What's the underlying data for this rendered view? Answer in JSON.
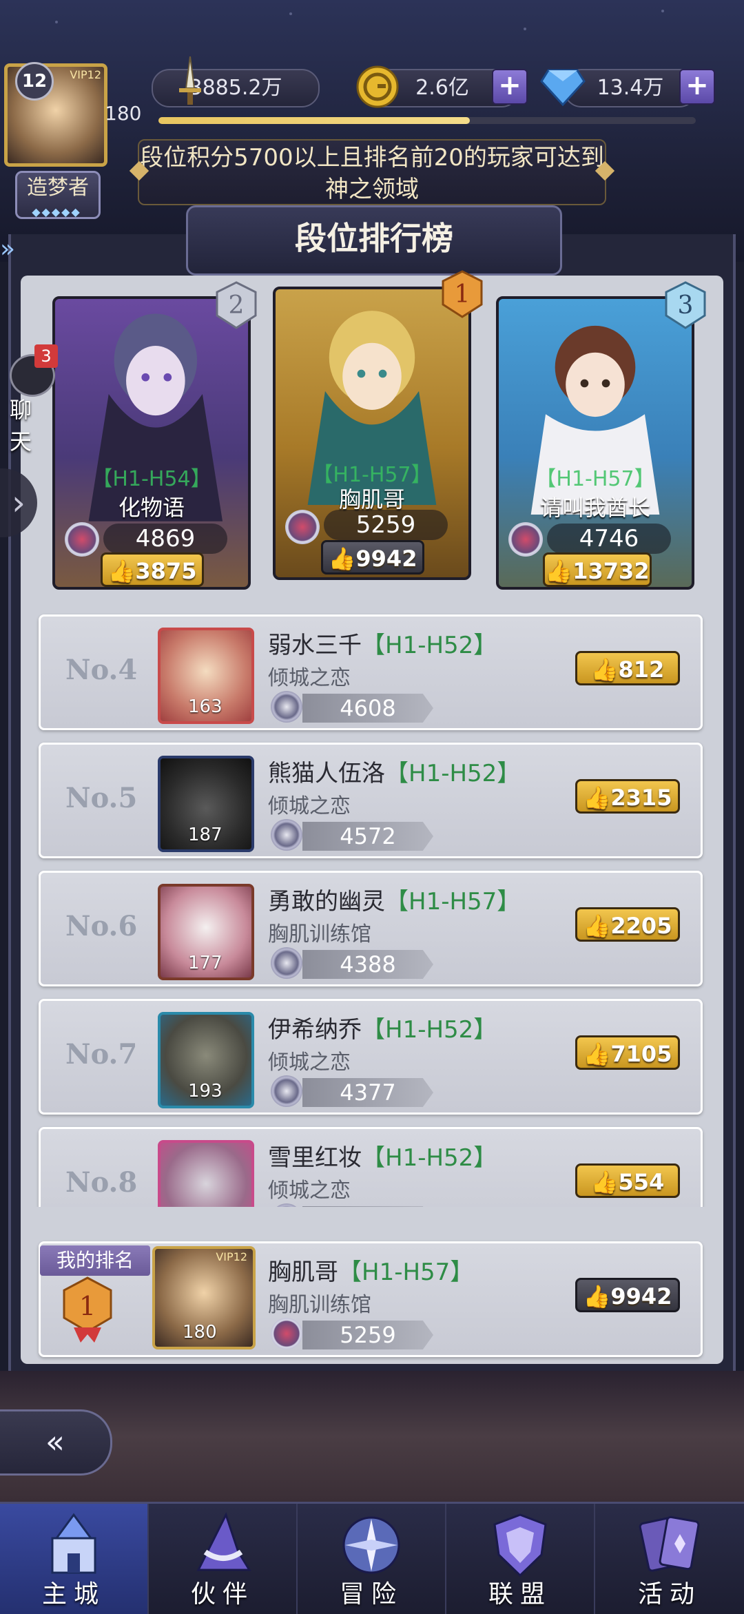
{
  "player": {
    "vip": "VIP12",
    "level_badge": "12",
    "level": "180",
    "title": "造梦者",
    "xp_fraction": 0.58
  },
  "resources": [
    {
      "icon": "sword-icon",
      "value": "3885.2万"
    },
    {
      "icon": "gold-coin-icon",
      "value": "2.6亿"
    },
    {
      "icon": "diamond-icon",
      "value": "13.4万"
    }
  ],
  "notice": "段位积分5700以上且排名前20的玩家可达到神之领域",
  "header": "段位排行榜",
  "chat": {
    "badge": "3",
    "label": "聊天"
  },
  "podium": [
    {
      "rank": "2",
      "server": "【H1-H54】",
      "name": "化物语",
      "score": "4869",
      "likes": "3875"
    },
    {
      "rank": "1",
      "server": "【H1-H57】",
      "name": "胸肌哥",
      "score": "5259",
      "likes": "9942"
    },
    {
      "rank": "3",
      "server": "【H1-H57】",
      "name": "请叫我酋长",
      "score": "4746",
      "likes": "13732"
    }
  ],
  "ranks": [
    {
      "no": "No.4",
      "name": "弱水三千",
      "server": "【H1-H52】",
      "guild": "倾城之恋",
      "level": "163",
      "score": "4608",
      "likes": "812"
    },
    {
      "no": "No.5",
      "name": "熊猫人伍洛",
      "server": "【H1-H52】",
      "guild": "倾城之恋",
      "level": "187",
      "score": "4572",
      "likes": "2315"
    },
    {
      "no": "No.6",
      "name": "勇敢的幽灵",
      "server": "【H1-H57】",
      "guild": "胸肌训练馆",
      "level": "177",
      "score": "4388",
      "likes": "2205"
    },
    {
      "no": "No.7",
      "name": "伊希纳乔",
      "server": "【H1-H52】",
      "guild": "倾城之恋",
      "level": "193",
      "score": "4377",
      "likes": "7105"
    },
    {
      "no": "No.8",
      "name": "雪里红妆",
      "server": "【H1-H52】",
      "guild": "倾城之恋",
      "level": "",
      "score": "",
      "likes": "554"
    }
  ],
  "my_rank": {
    "label": "我的排名",
    "rank": "1",
    "vip": "VIP12",
    "name": "胸肌哥",
    "server": "【H1-H57】",
    "guild": "胸肌训练馆",
    "level": "180",
    "score": "5259",
    "likes": "9942"
  },
  "nav": [
    {
      "label": "主城",
      "icon": "castle-icon"
    },
    {
      "label": "伙伴",
      "icon": "wizard-hat-icon"
    },
    {
      "label": "冒险",
      "icon": "compass-icon"
    },
    {
      "label": "联盟",
      "icon": "shield-icon"
    },
    {
      "label": "活动",
      "icon": "cards-icon"
    }
  ],
  "colors": {
    "accent_gold": "#f2c64e",
    "server_green": "#2e8c46",
    "nav_active": "#3a4aa0"
  }
}
